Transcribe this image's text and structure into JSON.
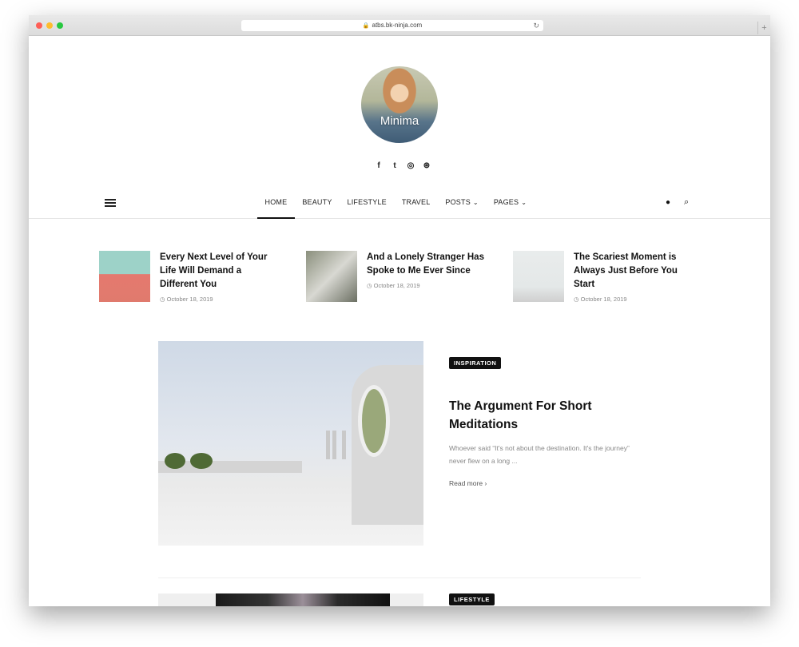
{
  "browser": {
    "url": "atbs.bk-ninja.com"
  },
  "site": {
    "brand": "Minima"
  },
  "social": [
    {
      "icon": "facebook-icon",
      "glyph": "f"
    },
    {
      "icon": "twitter-icon",
      "glyph": "t"
    },
    {
      "icon": "instagram-icon",
      "glyph": "◎"
    },
    {
      "icon": "dribbble-icon",
      "glyph": "⊛"
    }
  ],
  "nav": {
    "items": [
      {
        "label": "HOME",
        "active": true
      },
      {
        "label": "BEAUTY"
      },
      {
        "label": "LIFESTYLE"
      },
      {
        "label": "TRAVEL"
      },
      {
        "label": "POSTS",
        "dropdown": true
      },
      {
        "label": "PAGES",
        "dropdown": true
      }
    ]
  },
  "featured": [
    {
      "title": "Every Next Level of Your Life Will Demand a Different You",
      "date": "October 18, 2019"
    },
    {
      "title": "And a Lonely Stranger Has Spoke to Me Ever Since",
      "date": "October 18, 2019"
    },
    {
      "title": "The Scariest Moment is Always Just Before You Start",
      "date": "October 18, 2019"
    }
  ],
  "post": {
    "tag": "INSPIRATION",
    "title": "The Argument For Short Meditations",
    "excerpt": "Whoever said “It's not about the destination. It's the journey” never flew on a long ...",
    "readmore": "Read more"
  },
  "post2": {
    "tag": "LIFESTYLE"
  },
  "colors": {
    "accent": "#111111",
    "muted": "#888888"
  }
}
